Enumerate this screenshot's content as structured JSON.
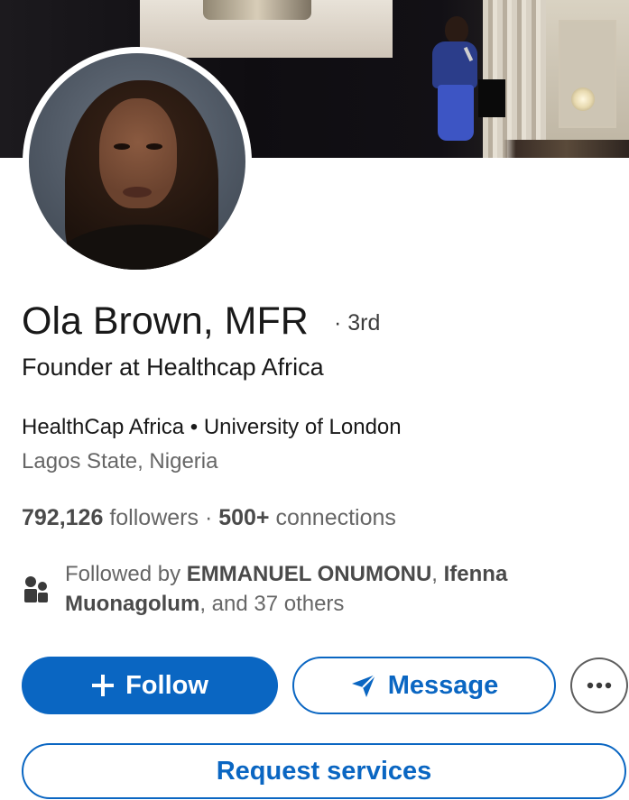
{
  "profile": {
    "name": "Ola Brown, MFR",
    "degree": "· 3rd",
    "headline": "Founder at Healthcap Africa",
    "education": "HealthCap Africa • University of London",
    "location": "Lagos State, Nigeria"
  },
  "stats": {
    "followers_count": "792,126",
    "followers_label": "followers",
    "separator": "·",
    "connections_count": "500+",
    "connections_label": "connections"
  },
  "mutual": {
    "prefix": "Followed by",
    "person1": "EMMANUEL ONUMONU",
    "comma": ",",
    "person2": "Ifenna Muonagolum",
    "suffix": ", and 37 others",
    "icon": "people-icon"
  },
  "actions": {
    "follow_label": "Follow",
    "message_label": "Message",
    "more_label": "•••",
    "request_label": "Request services"
  },
  "colors": {
    "accent": "#0a66c2",
    "text_primary": "#191919",
    "text_secondary": "#666666"
  }
}
